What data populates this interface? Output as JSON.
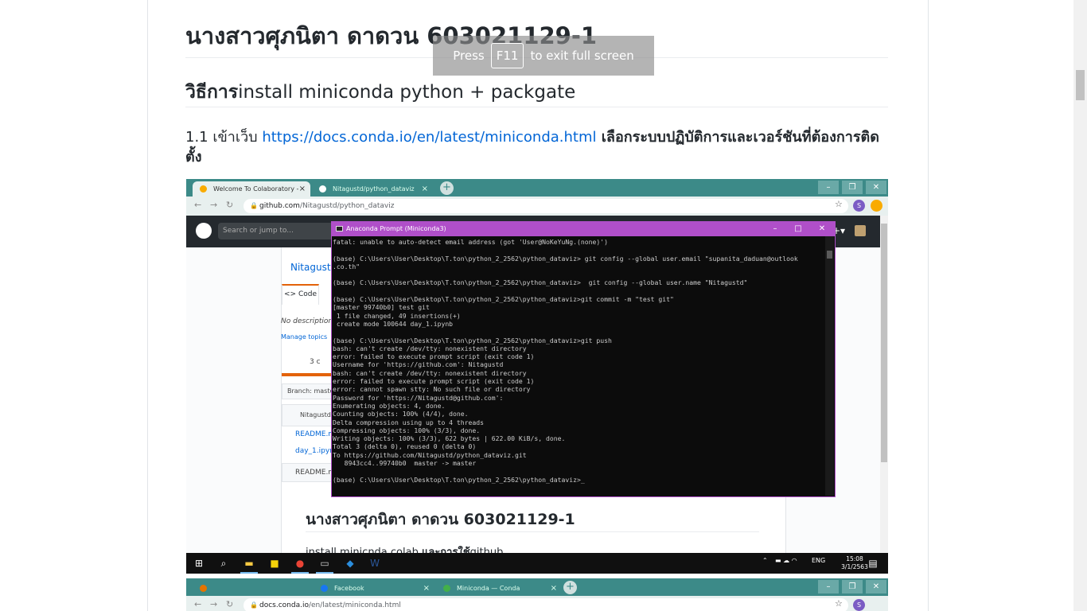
{
  "fullscreen_toast": {
    "press": "Press",
    "key": "F11",
    "rest": "to exit full screen"
  },
  "page": {
    "title": "นางสาวศุภนิตา ดาดวน 603021129-1",
    "section_bold": "วิธีการ",
    "section_rest": "install miniconda python + packgate",
    "step_prefix": "1.1 เข้าเว็บ ",
    "step_link": "https://docs.conda.io/en/latest/miniconda.html",
    "step_suffix": " เลือกระบบปฏิบัติการและเวอร์ชันที่ต้องการติดตั้ง"
  },
  "screenshot1": {
    "tabs": [
      {
        "label": "Welcome To Colaboratory - Colab",
        "close": "×"
      },
      {
        "label": "Nitagustd/python_dataviz",
        "close": "×"
      }
    ],
    "new_tab": "+",
    "window_controls": [
      "–",
      "❐",
      "✕"
    ],
    "url_host": "github.com",
    "url_path": "/Nitagustd/python_dataviz",
    "profile_initial": "S",
    "github": {
      "search_placeholder": "Search or jump to...",
      "plus": "+▾",
      "repo_owner": "Nitagustd",
      "code_tab": "<> Code",
      "no_description": "No description",
      "manage_topics": "Manage topics",
      "commits": "3 c",
      "branch": "Branch: master",
      "committer": "Nitagustd",
      "files": [
        "README.m",
        "day_1.ipynb"
      ],
      "readme_label": "README.m",
      "readme_heading": "นางสาวศุภนิตา ดาดวน 603021129-1",
      "readme_line_start": "install minicnda colab ",
      "readme_line_bold": "และการใช้",
      "readme_line_end": "github"
    },
    "terminal": {
      "title": "Anaconda Prompt (Miniconda3)",
      "controls": [
        "–",
        "□",
        "✕"
      ],
      "lines": [
        "fatal: unable to auto-detect email address (got 'User@NoKeYuNg.(none)')",
        "",
        "(base) C:\\Users\\User\\Desktop\\T.ton\\python_2_2562\\python_dataviz> git config --global user.email \"supanita_daduan@outlook",
        ".co.th\"",
        "",
        "(base) C:\\Users\\User\\Desktop\\T.ton\\python_2_2562\\python_dataviz>  git config --global user.name \"Nitagustd\"",
        "",
        "(base) C:\\Users\\User\\Desktop\\T.ton\\python_2_2562\\python_dataviz>git commit -m \"test git\"",
        "[master 99740b0] test git",
        " 1 file changed, 49 insertions(+)",
        " create mode 100644 day_1.ipynb",
        "",
        "(base) C:\\Users\\User\\Desktop\\T.ton\\python_2_2562\\python_dataviz>git push",
        "bash: can't create /dev/tty: nonexistent directory",
        "error: failed to execute prompt script (exit code 1)",
        "Username for 'https://github.com': Nitagustd",
        "bash: can't create /dev/tty: nonexistent directory",
        "error: failed to execute prompt script (exit code 1)",
        "error: cannot spawn stty: No such file or directory",
        "Password for 'https://Nitagustd@github.com':",
        "Enumerating objects: 4, done.",
        "Counting objects: 100% (4/4), done.",
        "Delta compression using up to 4 threads",
        "Compressing objects: 100% (3/3), done.",
        "Writing objects: 100% (3/3), 622 bytes | 622.00 KiB/s, done.",
        "Total 3 (delta 0), reused 0 (delta 0)",
        "To https://github.com/Nitagustd/python_dataviz.git",
        "   8943cc4..99740b0  master -> master",
        "",
        "(base) C:\\Users\\User\\Desktop\\T.ton\\python_2_2562\\python_dataviz>_"
      ]
    },
    "taskbar": {
      "tray_lang": "ENG",
      "clock_time": "15:08",
      "clock_date": "3/1/2563"
    }
  },
  "screenshot2": {
    "tabs": [
      {
        "label": "Facebook",
        "close": "×"
      },
      {
        "label": "Miniconda — Conda documentation",
        "close": "×"
      }
    ],
    "url_host": "docs.conda.io",
    "url_path": "/en/latest/miniconda.html",
    "profile_initial": "S"
  },
  "colors": {
    "link": "#0366d6",
    "chrome_frame": "#3c8a88",
    "terminal_title": "#b04fc9"
  }
}
